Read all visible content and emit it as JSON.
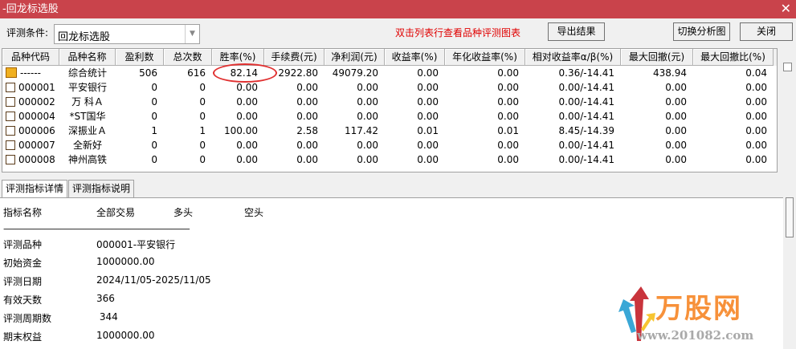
{
  "window": {
    "title": "-回龙标选股",
    "close": "✕"
  },
  "toolbar": {
    "condition_label": "评测条件:",
    "condition_value": "回龙标选股",
    "hint": "双击列表行查看品种评测图表",
    "export": "导出结果",
    "switch_chart": "切换分析图",
    "close": "关闭"
  },
  "table": {
    "columns": [
      "品种代码",
      "品种名称",
      "盈利数",
      "总次数",
      "胜率(%)",
      "手续费(元)",
      "净利润(元)",
      "收益率(%)",
      "年化收益率(%)",
      "相对收益率α/β(%)",
      "最大回撤(元)",
      "最大回撤比(%)"
    ],
    "rows": [
      [
        "------",
        "综合统计",
        "506",
        "616",
        "82.14",
        "2922.80",
        "49079.20",
        "0.00",
        "0.00",
        "0.36/-14.41",
        "438.94",
        "0.04"
      ],
      [
        "000001",
        "平安银行",
        "0",
        "0",
        "0.00",
        "0.00",
        "0.00",
        "0.00",
        "0.00",
        "0.00/-14.41",
        "0.00",
        "0.00"
      ],
      [
        "000002",
        "万 科Ａ",
        "0",
        "0",
        "0.00",
        "0.00",
        "0.00",
        "0.00",
        "0.00",
        "0.00/-14.41",
        "0.00",
        "0.00"
      ],
      [
        "000004",
        "*ST国华",
        "0",
        "0",
        "0.00",
        "0.00",
        "0.00",
        "0.00",
        "0.00",
        "0.00/-14.41",
        "0.00",
        "0.00"
      ],
      [
        "000006",
        "深振业Ａ",
        "1",
        "1",
        "100.00",
        "2.58",
        "117.42",
        "0.01",
        "0.01",
        "8.45/-14.39",
        "0.00",
        "0.00"
      ],
      [
        "000007",
        "全新好",
        "0",
        "0",
        "0.00",
        "0.00",
        "0.00",
        "0.00",
        "0.00",
        "0.00/-14.41",
        "0.00",
        "0.00"
      ],
      [
        "000008",
        "神州高铁",
        "0",
        "0",
        "0.00",
        "0.00",
        "0.00",
        "0.00",
        "0.00",
        "0.00/-14.41",
        "0.00",
        "0.00"
      ]
    ]
  },
  "tabs": [
    {
      "label": "评测指标详情",
      "active": true
    },
    {
      "label": "评测指标说明",
      "active": false
    }
  ],
  "detail": {
    "header": [
      "指标名称",
      "全部交易",
      "多头",
      "空头"
    ],
    "separator": "-----------------------------------------------------------------------------------------------",
    "items": [
      {
        "name": "评测品种",
        "value": "000001-平安银行"
      },
      {
        "name": "初始资金",
        "value": "1000000.00"
      },
      {
        "name": "评测日期",
        "value": "2024/11/05-2025/11/05"
      },
      {
        "name": "有效天数",
        "value": "366"
      },
      {
        "name": "评测周期数",
        "value": " 344"
      },
      {
        "name": "期末权益",
        "value": "1000000.00"
      }
    ]
  },
  "watermark": {
    "brand": "万股网",
    "url": "www.201082.com"
  },
  "colors": {
    "titlebar": "#c9434b",
    "hint": "#e00000",
    "highlight": "#e03030",
    "brand": "#f7913a"
  }
}
